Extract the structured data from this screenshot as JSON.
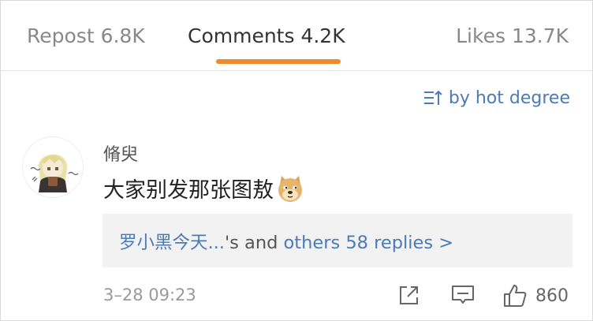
{
  "tabs": {
    "repost": "Repost 6.8K",
    "comments": "Comments 4.2K",
    "likes": "Likes 13.7K",
    "active": "comments",
    "accent_color": "#ee8a2e"
  },
  "sort": {
    "label": "by hot degree",
    "icon": "sort-icon"
  },
  "comment": {
    "username": "脩臾",
    "text": "大家别发那张图敖",
    "emoji": "doge-emoji",
    "replies": {
      "first_user": "罗小黑今天...",
      "middle": "'s and ",
      "others_link": "others 58 replies >"
    },
    "timestamp": "3–28 09:23",
    "like_count": "860"
  },
  "colors": {
    "link": "#4b7ab5",
    "muted": "#999999"
  }
}
